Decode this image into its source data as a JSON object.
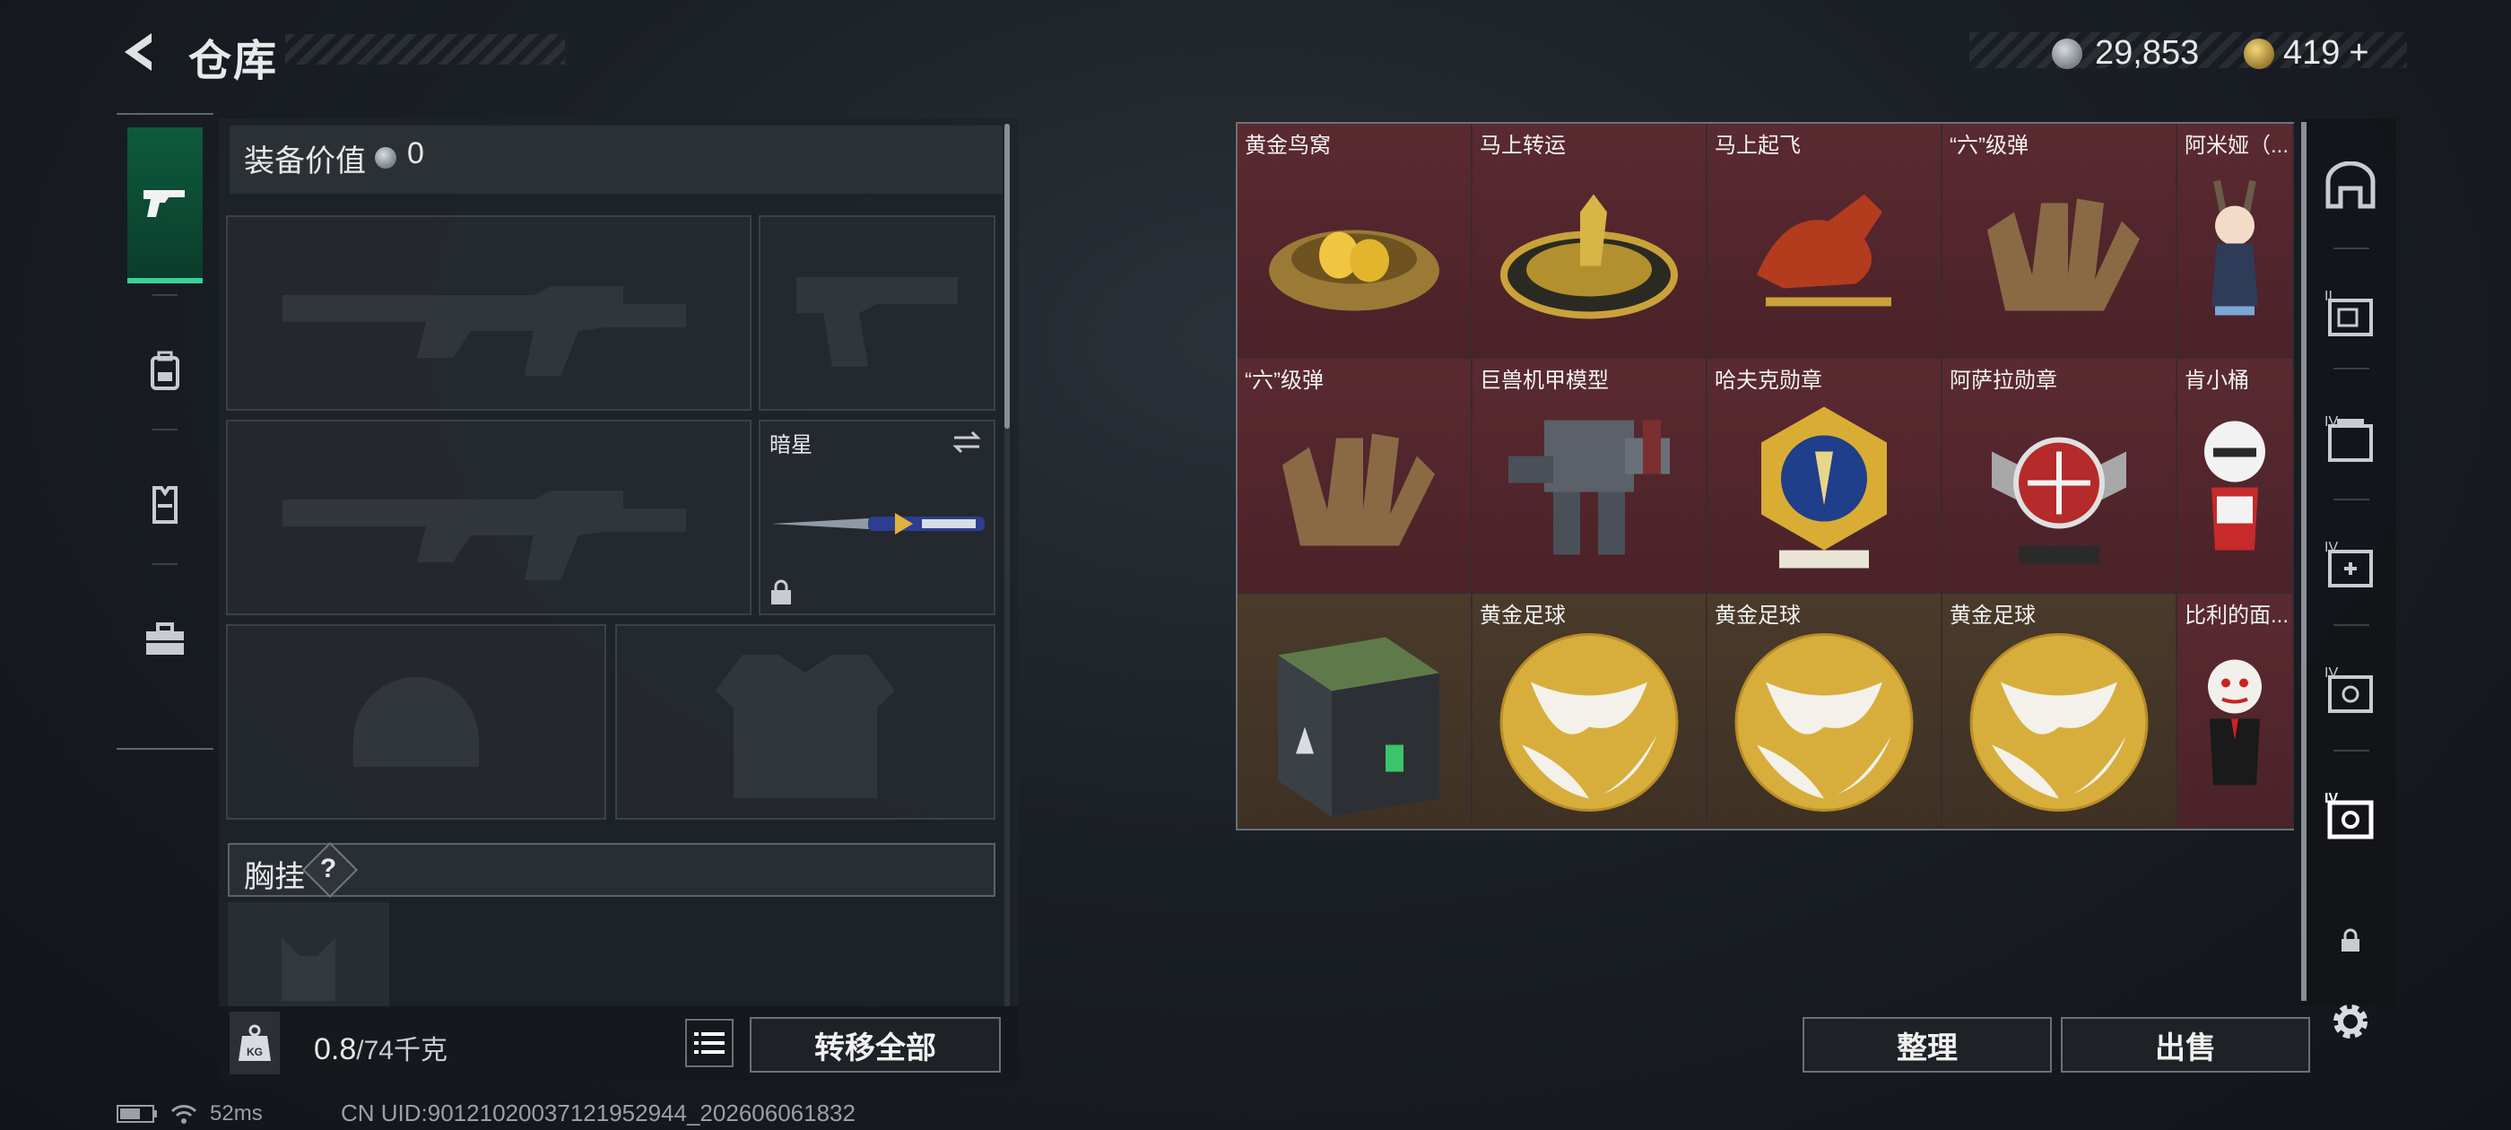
{
  "header": {
    "title": "仓库",
    "back_icon": "back-arrow-icon"
  },
  "currency": {
    "silver": "29,853",
    "gold": "419",
    "add_symbol": "+",
    "silver_icon": "silver-coin-icon",
    "gold_icon": "gold-coin-icon"
  },
  "left_nav": {
    "tabs": [
      {
        "icon": "pistol-icon",
        "active": true
      },
      {
        "icon": "backpack-icon",
        "active": false
      },
      {
        "icon": "vest-icon",
        "active": false
      },
      {
        "icon": "toolbox-icon",
        "active": false
      }
    ]
  },
  "equipment": {
    "title": "装备价值",
    "value": "0",
    "melee_label": "暗星",
    "chest_label": "胸挂",
    "help": "?"
  },
  "bottom": {
    "weight": "0.8",
    "weight_max": "/74千克",
    "kg_label": "KG",
    "transfer_all": "转移全部"
  },
  "grid": {
    "items": [
      {
        "name": "黄金鸟窝",
        "rarity": "red",
        "icon": "golden-nest-icon"
      },
      {
        "name": "马上转运",
        "rarity": "red",
        "icon": "fortune-disc-icon"
      },
      {
        "name": "马上起飞",
        "rarity": "red",
        "icon": "red-horse-icon"
      },
      {
        "name": "“六”级弹",
        "rarity": "red",
        "icon": "bullet-hand-icon"
      },
      {
        "name": "阿米娅（...",
        "rarity": "red",
        "icon": "amiya-figure-icon"
      },
      {
        "name": "“六”级弹",
        "rarity": "red",
        "icon": "bullet-hand-icon"
      },
      {
        "name": "巨兽机甲模型",
        "rarity": "red",
        "icon": "mech-model-icon"
      },
      {
        "name": "哈夫克勋章",
        "rarity": "red",
        "icon": "haavk-medal-icon"
      },
      {
        "name": "阿萨拉勋章",
        "rarity": "red",
        "icon": "asara-medal-icon"
      },
      {
        "name": "肯小桶",
        "rarity": "red",
        "icon": "kfc-figure-icon"
      },
      {
        "name": "",
        "rarity": "gold",
        "icon": "supply-crate-icon"
      },
      {
        "name": "黄金足球",
        "rarity": "gold",
        "icon": "golden-football-icon"
      },
      {
        "name": "黄金足球",
        "rarity": "gold",
        "icon": "golden-football-icon"
      },
      {
        "name": "黄金足球",
        "rarity": "gold",
        "icon": "golden-football-icon"
      },
      {
        "name": "比利的面...",
        "rarity": "red",
        "icon": "billy-puppet-icon"
      }
    ]
  },
  "actions": {
    "organize": "整理",
    "sell": "出售"
  },
  "right_rail": {
    "tiers": [
      "II",
      "IV",
      "IV",
      "IV",
      "IV"
    ]
  },
  "status": {
    "ping": "52ms",
    "uid": "CN UID:90121020037121952944_202606061832"
  },
  "colors": {
    "accent": "#38d39a",
    "red_rarity": "#5a2a31",
    "gold_rarity": "#4a3a2a"
  }
}
